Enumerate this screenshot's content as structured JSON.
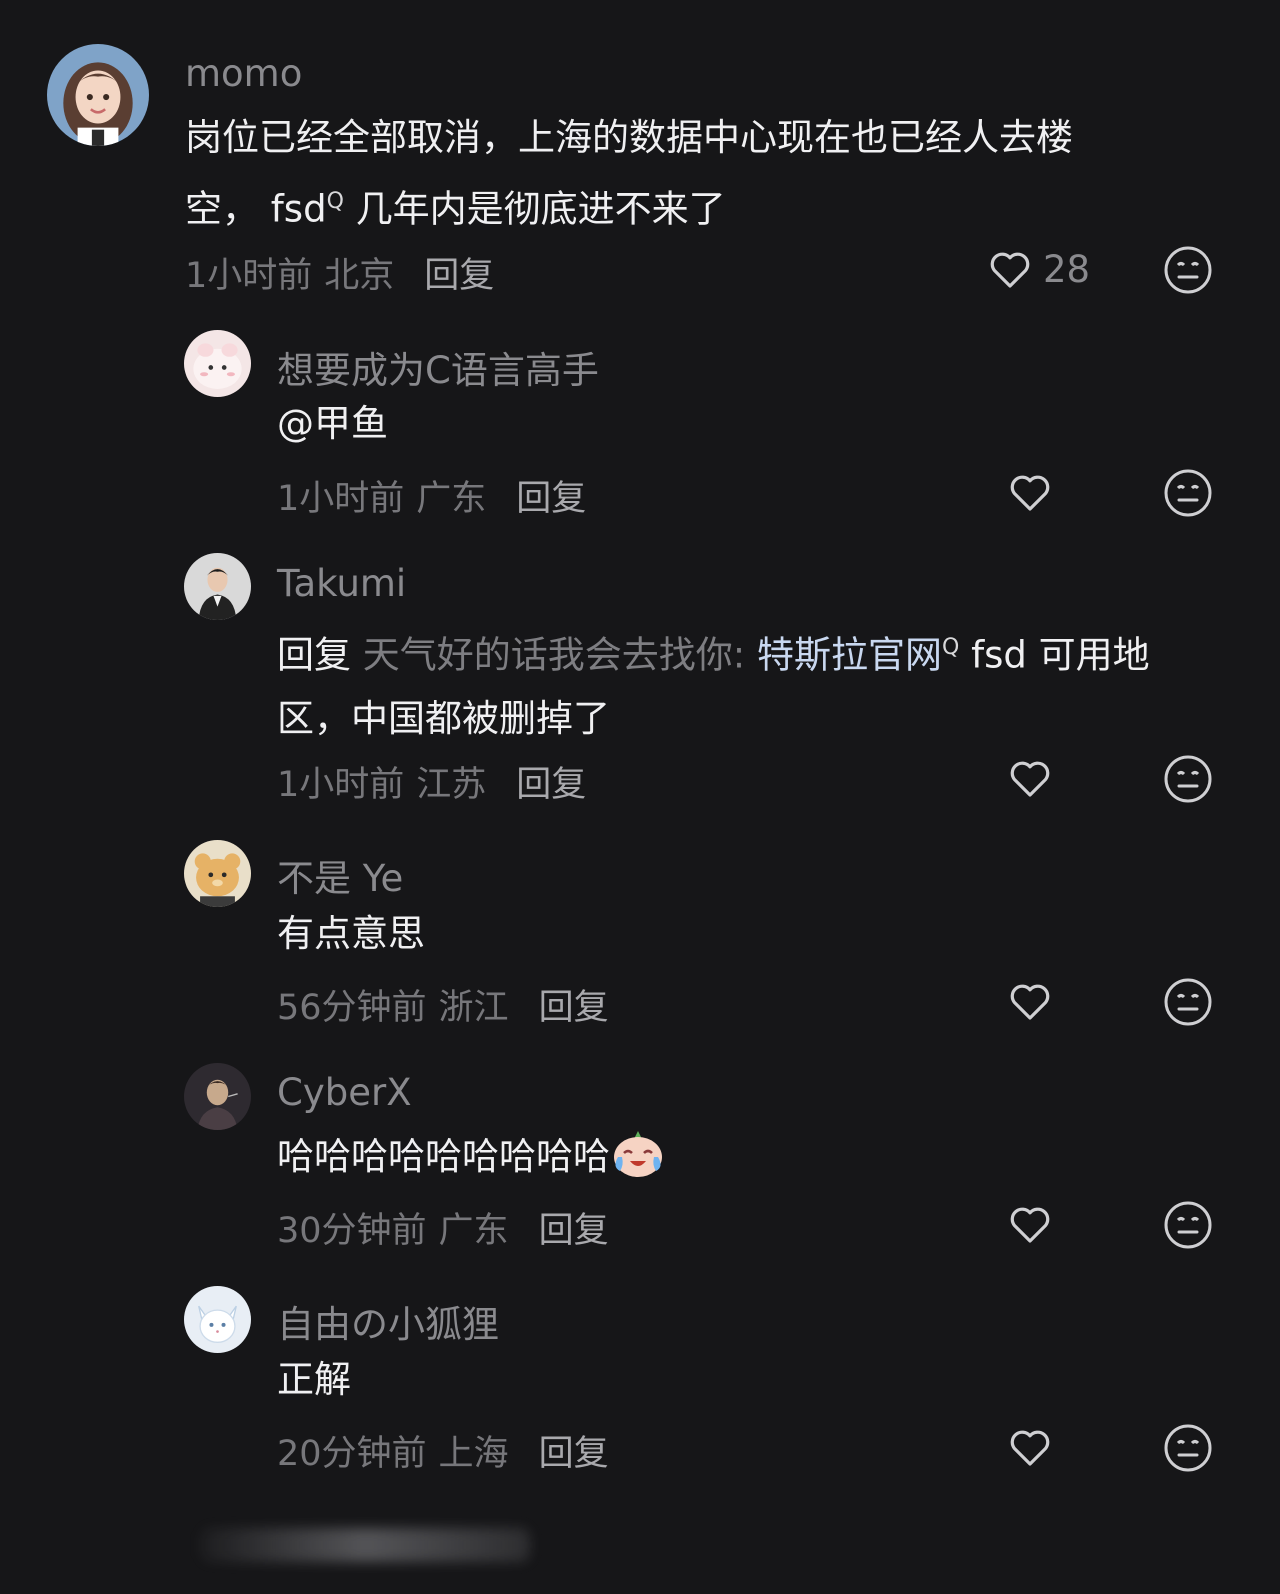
{
  "comments": [
    {
      "username": "momo",
      "text_line1": "岗位已经全部取消，上海的数据中心现在也已经人去楼",
      "text_line2_a": "空， fsd",
      "text_line2_b": " 几年内是彻底进不来了",
      "time": "1小时前",
      "location": "北京",
      "reply_label": "回复",
      "likes": "28",
      "search_icon": "search-superscript-icon",
      "avatar_colors": {
        "bg": "#7fa3c8",
        "face": "#f3d6c4",
        "hair": "#5a3e32"
      }
    },
    {
      "username": "想要成为C语言高手",
      "text": "@甲鱼",
      "time": "1小时前",
      "location": "广东",
      "reply_label": "回复",
      "avatar_colors": {
        "bg": "#f4e6e6",
        "face": "#f7d9dc"
      }
    },
    {
      "username": "Takumi",
      "reply_prefix": "回复",
      "reply_target": " 天气好的话我会去找你:",
      "link_text": " 特斯拉官网",
      "text_rest_line1": "  fsd 可用地",
      "text_line2": "区，中国都被删掉了",
      "time": "1小时前",
      "location": "江苏",
      "reply_label": "回复",
      "avatar_colors": {
        "bg": "#d9d9d9",
        "shirt": "#222222"
      }
    },
    {
      "username": "不是 Ye",
      "text": "有点意思",
      "time": "56分钟前",
      "location": "浙江",
      "reply_label": "回复",
      "avatar_colors": {
        "bg": "#e9dfc9",
        "bear": "#e6b266"
      }
    },
    {
      "username": "CyberX",
      "text": "哈哈哈哈哈哈哈哈哈",
      "emoji": "crying-laughing-emoji",
      "time": "30分钟前",
      "location": "广东",
      "reply_label": "回复",
      "avatar_colors": {
        "bg": "#2e2a30",
        "figure": "#c7a98c"
      }
    },
    {
      "username": "自由の小狐狸",
      "text": "正解",
      "time": "20分钟前",
      "location": "上海",
      "reply_label": "回复",
      "avatar_colors": {
        "bg": "#e8eef5",
        "fox": "#ffffff"
      }
    }
  ],
  "colors": {
    "background": "#161618",
    "username": "#8a8a8e",
    "meta": "#77777b",
    "link": "#c9d8f0"
  },
  "icons": {
    "like": "heart-outline-icon",
    "dislike": "meh-face-icon"
  }
}
